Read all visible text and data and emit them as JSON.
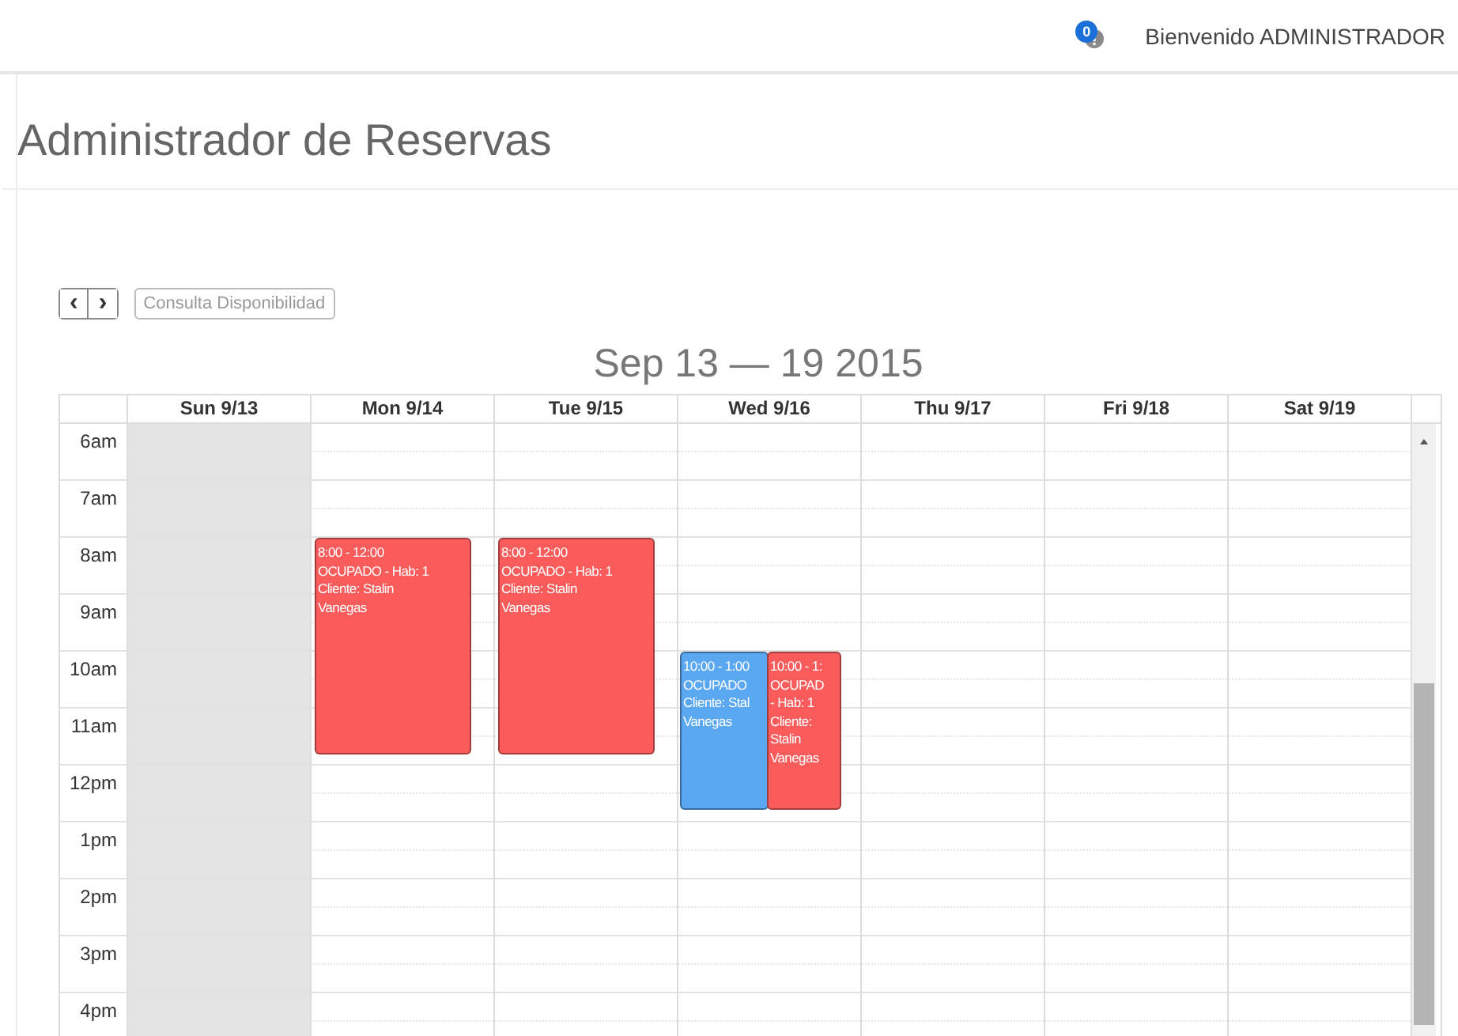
{
  "top_bar": {
    "notification_count": "0",
    "greeting": "Bienvenido ADMINISTRADOR"
  },
  "page_title": "Administrador de Reservas",
  "toolbar": {
    "prev": "‹",
    "next": "›",
    "availability_button": "Consulta Disponibilidad"
  },
  "calendar": {
    "range_title": "Sep 13 — 19 2015",
    "days": [
      {
        "label": "Sun 9/13",
        "shaded": true
      },
      {
        "label": "Mon 9/14",
        "shaded": false
      },
      {
        "label": "Tue 9/15",
        "shaded": false
      },
      {
        "label": "Wed 9/16",
        "shaded": false
      },
      {
        "label": "Thu 9/17",
        "shaded": false
      },
      {
        "label": "Fri 9/18",
        "shaded": false
      },
      {
        "label": "Sat 9/19",
        "shaded": false
      }
    ],
    "hours": [
      "6am",
      "7am",
      "8am",
      "9am",
      "10am",
      "11am",
      "12pm",
      "1pm",
      "2pm",
      "3pm",
      "4pm"
    ],
    "events": [
      {
        "color": "#fa5c5c",
        "lines": [
          "8:00 - 12:00",
          "OCUPADO - Hab: 1",
          "Cliente: Stalin",
          "Vanegas"
        ]
      },
      {
        "color": "#fa5c5c",
        "lines": [
          "8:00 - 12:00",
          "OCUPADO - Hab: 1",
          "Cliente: Stalin",
          "Vanegas"
        ]
      },
      {
        "color": "#5aa7f2",
        "lines": [
          "10:00 - 1:00",
          "OCUPADO",
          "Cliente: Stal",
          "Vanegas"
        ]
      },
      {
        "color": "#fa5c5c",
        "lines": [
          "10:00 - 1:",
          "OCUPAD",
          "- Hab: 1",
          "Cliente:",
          "Stalin",
          "Vanegas"
        ]
      }
    ]
  }
}
